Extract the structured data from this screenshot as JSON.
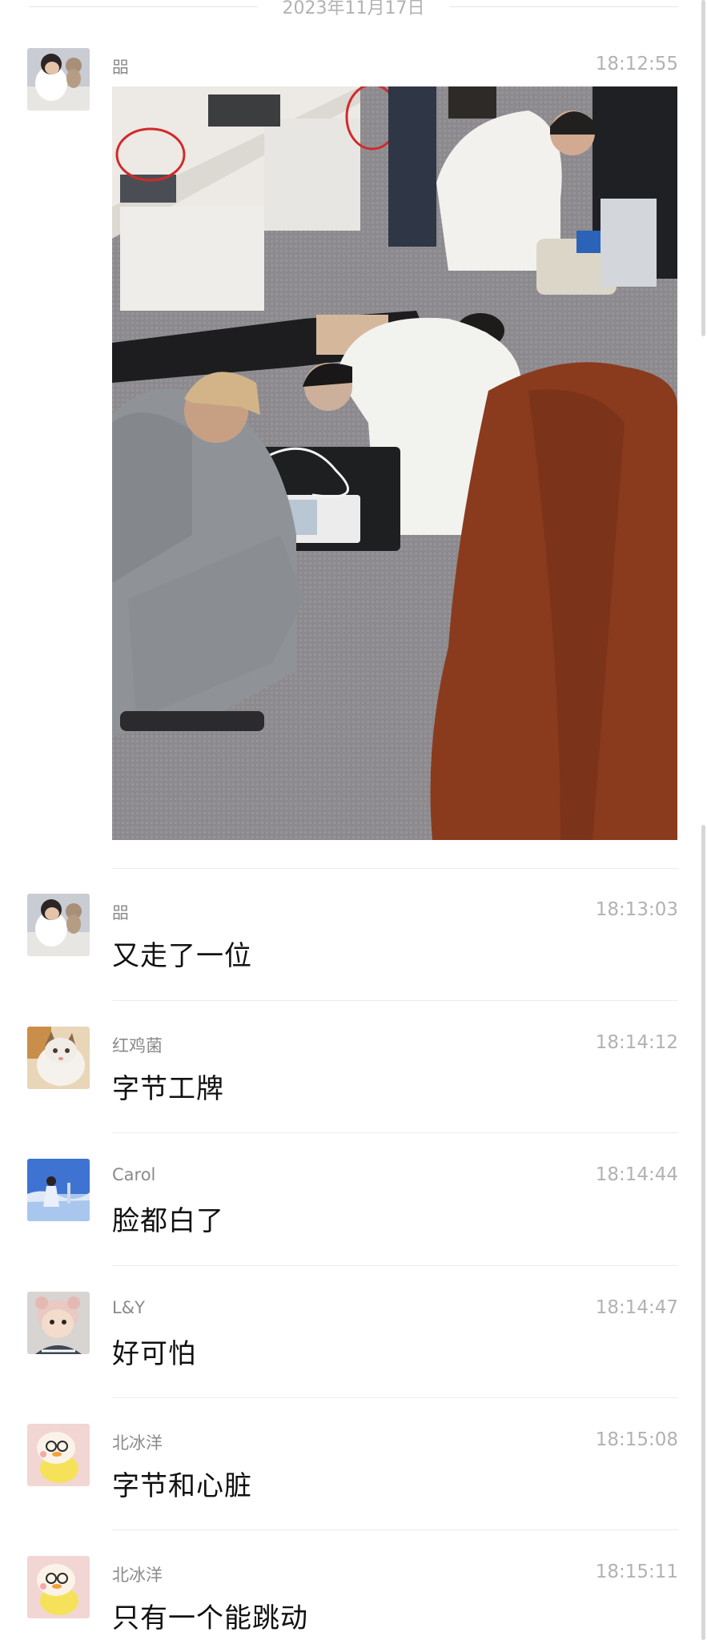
{
  "date_separator": "2023年11月17日",
  "messages": [
    {
      "sender": "㗊",
      "time": "18:12:55",
      "type": "image",
      "image": {
        "subject": "photo"
      }
    },
    {
      "sender": "㗊",
      "time": "18:13:03",
      "type": "text",
      "text": "又走了一位"
    },
    {
      "sender": "红鸡菌",
      "time": "18:14:12",
      "type": "text",
      "text": "字节工牌"
    },
    {
      "sender": "Carol",
      "time": "18:14:44",
      "type": "text",
      "text": "脸都白了"
    },
    {
      "sender": "L&Y",
      "time": "18:14:47",
      "type": "text",
      "text": "好可怕"
    },
    {
      "sender": "北冰洋",
      "time": "18:15:08",
      "type": "text",
      "text": "字节和心脏"
    },
    {
      "sender": "北冰洋",
      "time": "18:15:11",
      "type": "text",
      "text": "只有一个能跳动"
    }
  ],
  "colors": {
    "background": "#ffffff",
    "timestamp": "#b2b2b2",
    "sender": "#8a8a8a",
    "message_text": "#111111",
    "divider": "#ececec"
  },
  "icons": [
    "avatar-boy-with-cat",
    "avatar-cat",
    "avatar-girl-sky",
    "avatar-baby",
    "avatar-yellow-duck"
  ]
}
